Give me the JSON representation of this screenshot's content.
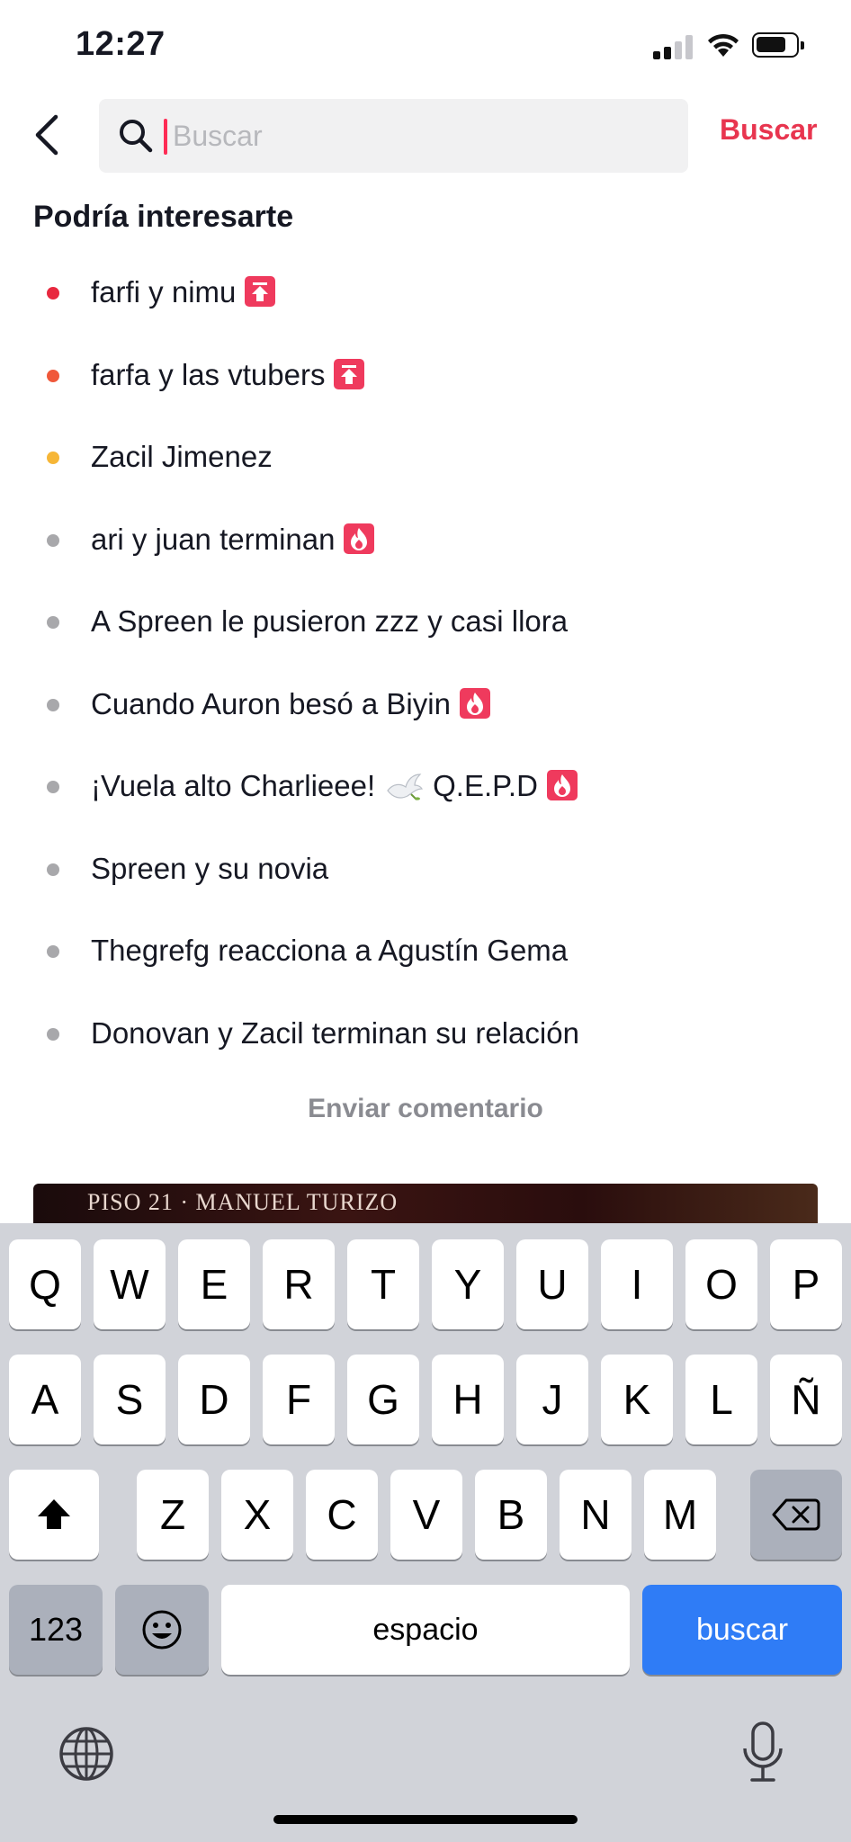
{
  "status_bar": {
    "time": "12:27"
  },
  "header": {
    "search_placeholder": "Buscar",
    "search_button": "Buscar"
  },
  "section_title": "Podría interesarte",
  "suggestions": [
    {
      "text": "farfi y nimu",
      "dot_color": "#e8283f",
      "badge": "trending-up"
    },
    {
      "text": "farfa y las vtubers",
      "dot_color": "#f0583a",
      "badge": "trending-up"
    },
    {
      "text": "Zacil Jimenez",
      "dot_color": "#f6b637",
      "badge": ""
    },
    {
      "text": "ari y juan terminan",
      "dot_color": "#a8a8ab",
      "badge": "hot"
    },
    {
      "text": "A Spreen le pusieron zzz y casi llora",
      "dot_color": "#a8a8ab",
      "badge": ""
    },
    {
      "text": "Cuando Auron besó a Biyin",
      "dot_color": "#a8a8ab",
      "badge": "hot"
    },
    {
      "text": "¡Vuela alto Charlieee!",
      "text_after": "Q.E.P.D",
      "dot_color": "#a8a8ab",
      "badge": "hot",
      "emoji": "dove"
    },
    {
      "text": "Spreen y su novia",
      "dot_color": "#a8a8ab",
      "badge": ""
    },
    {
      "text": "Thegrefg reacciona a Agustín Gema",
      "dot_color": "#a8a8ab",
      "badge": ""
    },
    {
      "text": "Donovan y Zacil terminan su relación",
      "dot_color": "#a8a8ab",
      "badge": ""
    }
  ],
  "feedback_link": "Enviar comentario",
  "thumbnail_caption": "PISO 21 · MANUEL TURIZO",
  "keyboard": {
    "row1": [
      "Q",
      "W",
      "E",
      "R",
      "T",
      "Y",
      "U",
      "I",
      "O",
      "P"
    ],
    "row2": [
      "A",
      "S",
      "D",
      "F",
      "G",
      "H",
      "J",
      "K",
      "L",
      "Ñ"
    ],
    "row3": [
      "Z",
      "X",
      "C",
      "V",
      "B",
      "N",
      "M"
    ],
    "numbers_key": "123",
    "space_key": "espacio",
    "return_key": "buscar"
  },
  "colors": {
    "accent": "#fe2c55",
    "search_red": "#e8354f",
    "keyboard_blue": "#2f7cf6"
  }
}
